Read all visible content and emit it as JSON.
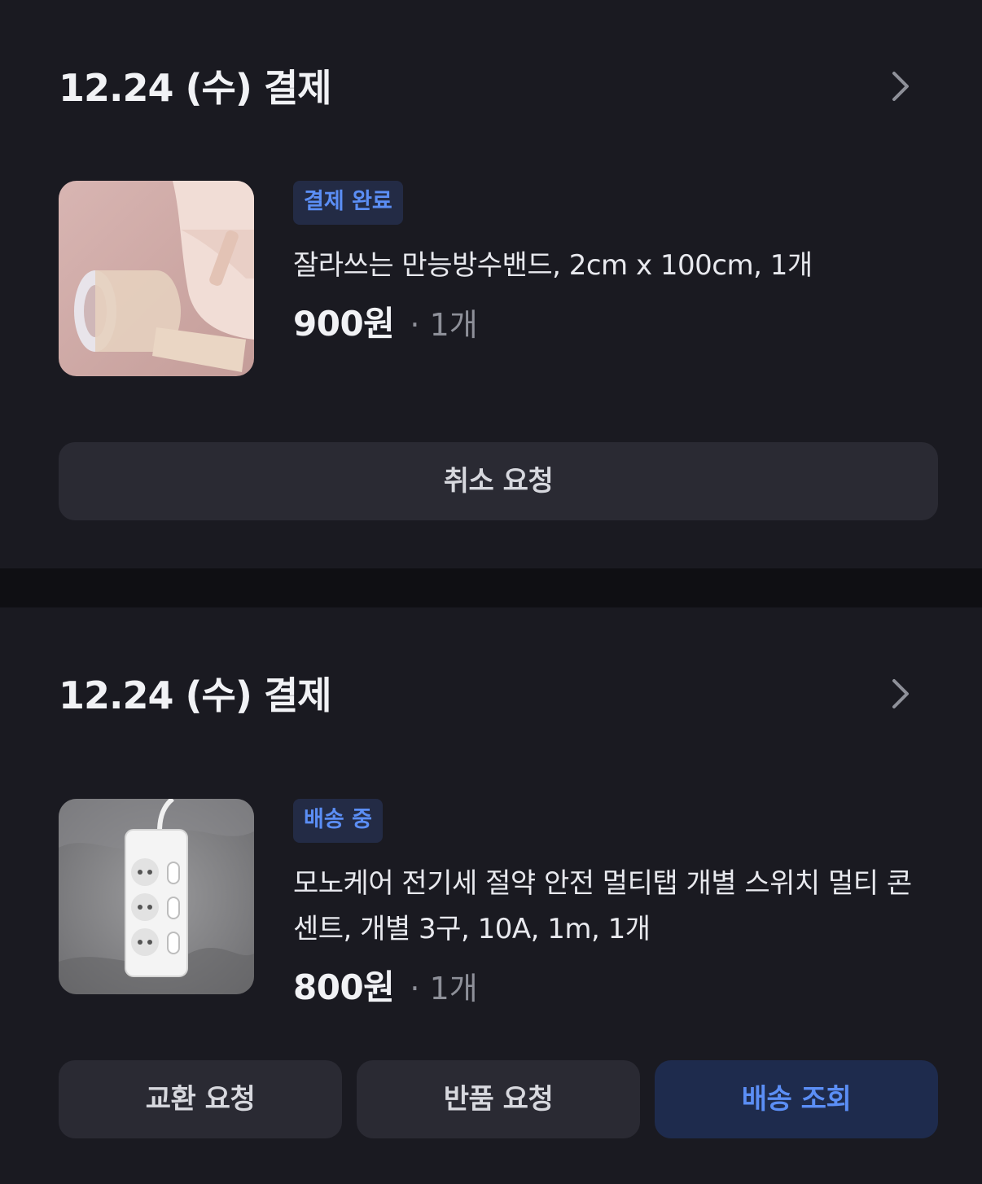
{
  "orders": [
    {
      "date": "12.24 (수) 결제",
      "status": "결제 완료",
      "product_name": "잘라쓰는 만능방수밴드, 2cm x 100cm, 1개",
      "price": "900원",
      "quantity": "· 1개",
      "thumbnail_icon": "waterproof-tape-roll-image",
      "actions": [
        "취소 요청"
      ]
    },
    {
      "date": "12.24 (수) 결제",
      "status": "배송 중",
      "product_name": "모노케어 전기세 절약 안전 멀티탭 개별 스위치 멀티 콘센트, 개별 3구, 10A, 1m, 1개",
      "price": "800원",
      "quantity": "· 1개",
      "thumbnail_icon": "power-strip-image",
      "actions": [
        "교환 요청",
        "반품 요청",
        "배송 조회"
      ]
    }
  ],
  "colors": {
    "background": "#0f0f13",
    "card": "#1a1a21",
    "button": "#2a2a33",
    "accent": "#5b8ef5",
    "badge_bg": "#232b45"
  },
  "icons": {
    "chevron": "chevron-right-icon"
  }
}
